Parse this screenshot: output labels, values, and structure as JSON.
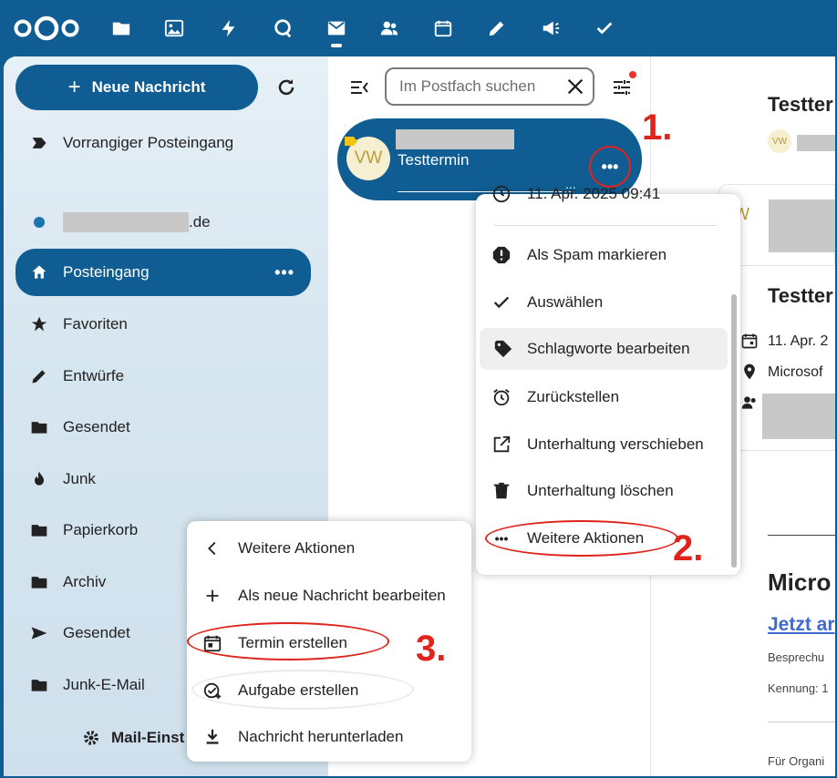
{
  "header": {
    "apps": [
      "files-icon",
      "photos-icon",
      "activity-icon",
      "talk-icon",
      "mail-icon",
      "contacts-icon",
      "calendar-icon",
      "notes-icon",
      "announcements-icon",
      "tasks-icon"
    ]
  },
  "sidebar": {
    "new_message": "Neue Nachricht",
    "priority_inbox": "Vorrangiger Posteingang",
    "account_suffix": ".de",
    "inbox": "Posteingang",
    "inbox_more": "•••",
    "folders": [
      "Favoriten",
      "Entwürfe",
      "Gesendet",
      "Junk",
      "Papierkorb",
      "Archiv",
      "Gesendet",
      "Junk-E-Mail"
    ],
    "settings": "Mail-Einst"
  },
  "list": {
    "search_placeholder": "Im Postfach suchen",
    "message": {
      "avatar": "VW",
      "subject": "Testtermin",
      "more": "•••",
      "ellipsis": "..."
    }
  },
  "menu1": {
    "date": "11. Apr. 2025 09:41",
    "items": [
      "Als Spam markieren",
      "Auswählen",
      "Schlagworte bearbeiten",
      "Zurückstellen",
      "Unterhaltung verschieben",
      "Unterhaltung löschen",
      "Weitere Aktionen"
    ]
  },
  "menu2": {
    "items": [
      "Weitere Aktionen",
      "Als neue Nachricht bearbeiten",
      "Termin erstellen",
      "Aufgabe erstellen",
      "Nachricht herunterladen"
    ]
  },
  "reader": {
    "title1": "Testter",
    "avatar_small": "VW",
    "title2": "Testter",
    "date": "11. Apr. 2",
    "location": "Microsof",
    "heading": "Micro",
    "link": "Jetzt ar",
    "line1": "Besprechu",
    "line2": "Kennung: 1",
    "line3": "Für Organi"
  },
  "annotations": {
    "step1": "1.",
    "step2": "2.",
    "step3": "3."
  },
  "colors": {
    "brand": "#0f5d92",
    "annotation": "#e0241b"
  }
}
